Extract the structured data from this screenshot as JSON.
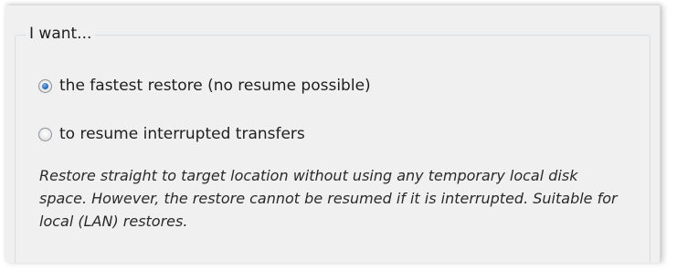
{
  "group": {
    "legend": "I want..."
  },
  "options": [
    {
      "label": "the fastest restore (no resume possible)",
      "checked": true
    },
    {
      "label": "to resume interrupted transfers",
      "checked": false
    }
  ],
  "description": "Restore straight to target location without using any temporary local disk space. However, the restore cannot be resumed if it is interrupted. Suitable for local (LAN) restores.",
  "colors": {
    "background": "#f0f0f0",
    "groupbox_border": "#d5dfe5",
    "radio_selected": "#2a6fc0"
  }
}
